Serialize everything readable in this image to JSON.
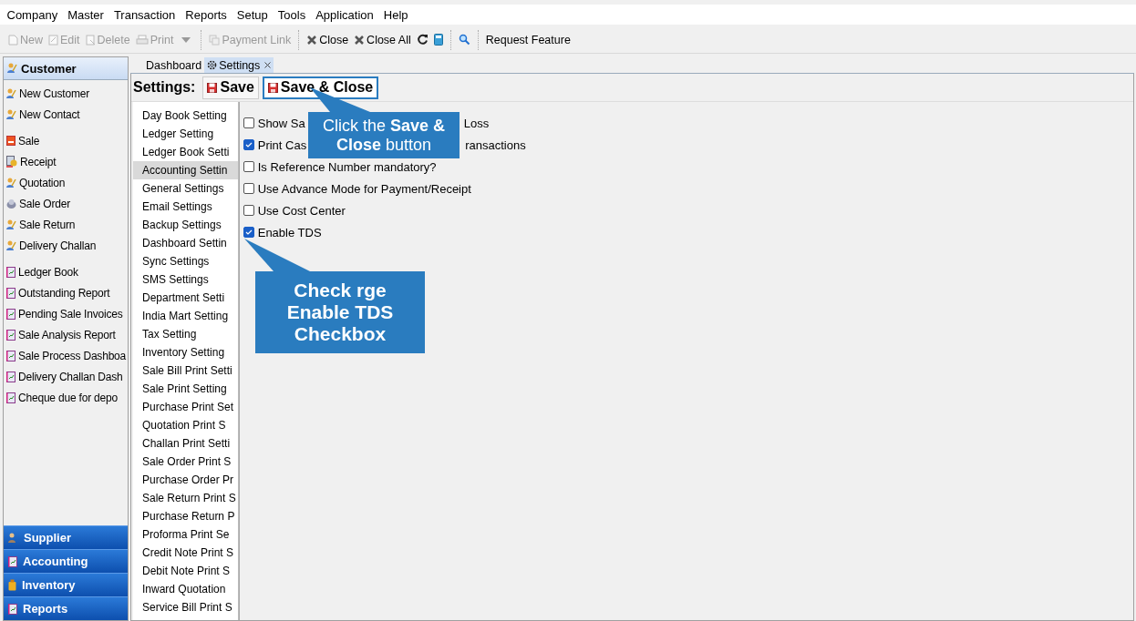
{
  "menu": [
    "Company",
    "Master",
    "Transaction",
    "Reports",
    "Setup",
    "Tools",
    "Application",
    "Help"
  ],
  "toolbar": [
    {
      "kind": "button",
      "label": "New",
      "disabled": true
    },
    {
      "kind": "button",
      "label": "Edit",
      "disabled": true
    },
    {
      "kind": "button",
      "label": "Delete",
      "disabled": true
    },
    {
      "kind": "button",
      "label": "Print",
      "disabled": true
    },
    {
      "kind": "dropdown",
      "disabled": true
    },
    {
      "kind": "separator"
    },
    {
      "kind": "button",
      "label": "Payment Link",
      "disabled": true
    },
    {
      "kind": "separator"
    },
    {
      "kind": "button",
      "label": "Close",
      "disabled": false
    },
    {
      "kind": "button",
      "label": "Close All",
      "disabled": false
    },
    {
      "kind": "icon_button",
      "disabled": false
    },
    {
      "kind": "icon_button",
      "disabled": false
    },
    {
      "kind": "separator"
    },
    {
      "kind": "icon_button",
      "disabled": false
    },
    {
      "kind": "separator"
    },
    {
      "kind": "text_button",
      "label": "Request Feature",
      "disabled": false
    }
  ],
  "sidebar": {
    "header": {
      "label": "Customer",
      "selected": true
    },
    "groups": [
      [
        {
          "label": "New Customer"
        },
        {
          "label": "New Contact"
        }
      ],
      [
        {
          "label": "Sale"
        },
        {
          "label": "Receipt"
        },
        {
          "label": "Quotation"
        },
        {
          "label": "Sale Order"
        },
        {
          "label": "Sale Return"
        },
        {
          "label": "Delivery Challan"
        }
      ],
      [
        {
          "label": "Ledger Book"
        },
        {
          "label": "Outstanding Report"
        },
        {
          "label": "Pending Sale Invoices"
        },
        {
          "label": "Sale Analysis Report"
        },
        {
          "label": "Sale Process Dashboa"
        },
        {
          "label": "Delivery Challan Dash"
        },
        {
          "label": "Cheque due for depo"
        }
      ]
    ],
    "sections": [
      {
        "label": "Supplier"
      },
      {
        "label": "Accounting"
      },
      {
        "label": "Inventory"
      },
      {
        "label": "Reports"
      }
    ]
  },
  "tabs": [
    {
      "label": "Dashboard",
      "selected": false,
      "closable": false
    },
    {
      "label": "Settings",
      "selected": true,
      "closable": true
    }
  ],
  "settings": {
    "title": "Settings:",
    "buttons": [
      {
        "label": "Save",
        "focused": false
      },
      {
        "label": "Save & Close",
        "focused": true
      }
    ],
    "categories": [
      {
        "label": "Day Book Setting",
        "selected": false
      },
      {
        "label": "Ledger Setting",
        "selected": false
      },
      {
        "label": "Ledger Book Setti",
        "selected": false
      },
      {
        "label": "Accounting Settin",
        "selected": true
      },
      {
        "label": "General Settings",
        "selected": false
      },
      {
        "label": "Email Settings",
        "selected": false
      },
      {
        "label": "Backup Settings",
        "selected": false
      },
      {
        "label": "Dashboard Settin",
        "selected": false
      },
      {
        "label": "Sync Settings",
        "selected": false
      },
      {
        "label": "SMS Settings",
        "selected": false
      },
      {
        "label": "Department Setti",
        "selected": false
      },
      {
        "label": "India Mart Setting",
        "selected": false
      },
      {
        "label": "Tax Setting",
        "selected": false
      },
      {
        "label": "Inventory Setting",
        "selected": false
      },
      {
        "label": "Sale Bill Print Setti",
        "selected": false
      },
      {
        "label": "Sale Print Setting",
        "selected": false
      },
      {
        "label": "Purchase Print Set",
        "selected": false
      },
      {
        "label": "Quotation Print S",
        "selected": false
      },
      {
        "label": "Challan Print Setti",
        "selected": false
      },
      {
        "label": "Sale Order Print S",
        "selected": false
      },
      {
        "label": "Purchase Order Pr",
        "selected": false
      },
      {
        "label": "Sale Return Print S",
        "selected": false
      },
      {
        "label": "Purchase Return P",
        "selected": false
      },
      {
        "label": "Proforma Print Se",
        "selected": false
      },
      {
        "label": "Credit Note Print S",
        "selected": false
      },
      {
        "label": "Debit Note Print S",
        "selected": false
      },
      {
        "label": "Inward Quotation",
        "selected": false
      },
      {
        "label": "Service Bill Print S",
        "selected": false
      }
    ],
    "options": [
      {
        "label": "Show Sa",
        "label_end": "Loss",
        "checked": false
      },
      {
        "label": "Print Cas",
        "label_end": "ransactions",
        "checked": true
      },
      {
        "label": "Is Reference Number mandatory?",
        "checked": false
      },
      {
        "label": "Use Advance Mode for Payment/Receipt",
        "checked": false
      },
      {
        "label": "Use Cost Center",
        "checked": false
      },
      {
        "label": "Enable TDS",
        "checked": true
      }
    ]
  },
  "callouts": [
    {
      "text": "Click the **Save & Close** button"
    },
    {
      "text": "Check rge Enable TDS Checkbox"
    }
  ]
}
